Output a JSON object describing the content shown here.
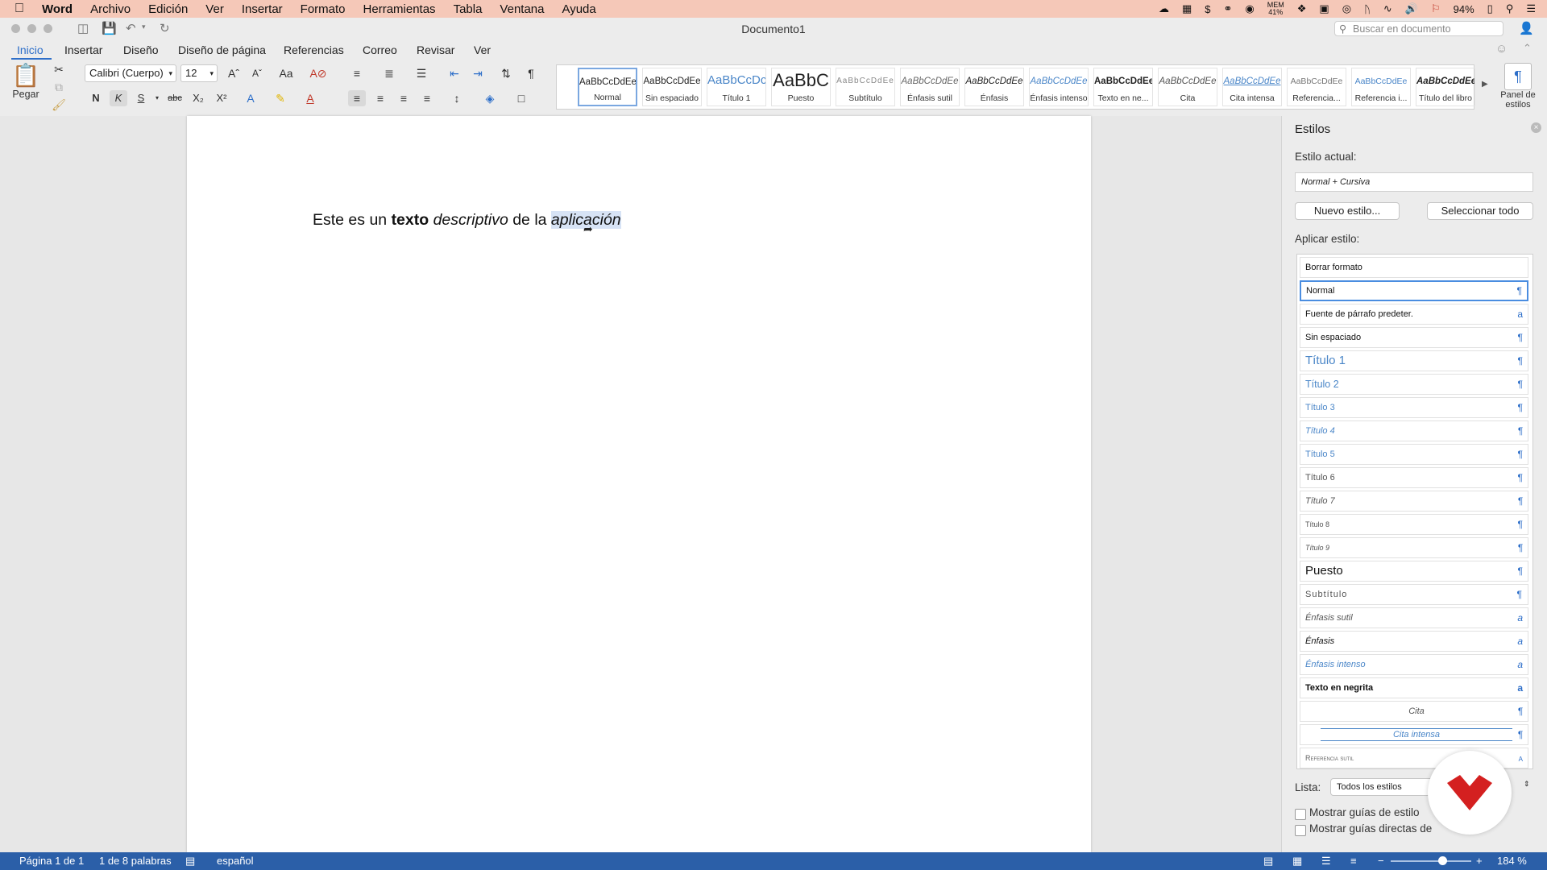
{
  "menubar": {
    "app": "Word",
    "items": [
      "Archivo",
      "Edición",
      "Ver",
      "Insertar",
      "Formato",
      "Herramientas",
      "Tabla",
      "Ventana",
      "Ayuda"
    ],
    "mem_label": "MEM",
    "mem_value": "41%",
    "battery": "94%"
  },
  "window": {
    "title": "Documento1",
    "search_placeholder": "Buscar en documento"
  },
  "tabs": [
    "Inicio",
    "Insertar",
    "Diseño",
    "Diseño de página",
    "Referencias",
    "Correo",
    "Revisar",
    "Ver"
  ],
  "ribbon": {
    "paste_label": "Pegar",
    "font_name": "Calibri (Cuerpo)",
    "font_size": "12",
    "bold": "N",
    "italic": "K",
    "underline": "S",
    "strike": "abc",
    "panel_label_1": "Panel de",
    "panel_label_2": "estilos",
    "styles": [
      {
        "preview": "AaBbCcDdEe",
        "label": "Normal"
      },
      {
        "preview": "AaBbCcDdEe",
        "label": "Sin espaciado"
      },
      {
        "preview": "AaBbCcDc",
        "label": "Título 1"
      },
      {
        "preview": "AaBbC",
        "label": "Puesto"
      },
      {
        "preview": "AaBbCcDdEe",
        "label": "Subtítulo"
      },
      {
        "preview": "AaBbCcDdEe",
        "label": "Énfasis sutil"
      },
      {
        "preview": "AaBbCcDdEe",
        "label": "Énfasis"
      },
      {
        "preview": "AaBbCcDdEe",
        "label": "Énfasis intenso"
      },
      {
        "preview": "AaBbCcDdEe",
        "label": "Texto en ne..."
      },
      {
        "preview": "AaBbCcDdEe",
        "label": "Cita"
      },
      {
        "preview": "AaBbCcDdEe",
        "label": "Cita intensa"
      },
      {
        "preview": "AaBbCcDdEe",
        "label": "Referencia..."
      },
      {
        "preview": "AaBbCcDdEe",
        "label": "Referencia i..."
      },
      {
        "preview": "AaBbCcDdEe",
        "label": "Título del libro"
      }
    ]
  },
  "document": {
    "part1": "Este es un ",
    "part2_bold": "texto",
    "part3": " ",
    "part4_italic": "descriptivo",
    "part5": " de la ",
    "part6_selected": "aplicación"
  },
  "styles_panel": {
    "title": "Estilos",
    "current_label": "Estilo actual:",
    "current_value": "Normal + Cursiva",
    "new_style": "Nuevo estilo...",
    "select_all": "Seleccionar todo",
    "apply_label": "Aplicar estilo:",
    "list": [
      {
        "name": "Borrar formato",
        "sym": ""
      },
      {
        "name": "Normal",
        "sym": "¶"
      },
      {
        "name": "Fuente de párrafo predeter.",
        "sym": "a"
      },
      {
        "name": "Sin espaciado",
        "sym": "¶"
      },
      {
        "name": "Título 1",
        "sym": "¶"
      },
      {
        "name": "Título 2",
        "sym": "¶"
      },
      {
        "name": "Título 3",
        "sym": "¶"
      },
      {
        "name": "Título 4",
        "sym": "¶"
      },
      {
        "name": "Título 5",
        "sym": "¶"
      },
      {
        "name": "Título 6",
        "sym": "¶"
      },
      {
        "name": "Título 7",
        "sym": "¶"
      },
      {
        "name": "Título 8",
        "sym": "¶"
      },
      {
        "name": "Título 9",
        "sym": "¶"
      },
      {
        "name": "Puesto",
        "sym": "¶"
      },
      {
        "name": "Subtítulo",
        "sym": "¶"
      },
      {
        "name": "Énfasis sutil",
        "sym": "a"
      },
      {
        "name": "Énfasis",
        "sym": "a"
      },
      {
        "name": "Énfasis intenso",
        "sym": "a"
      },
      {
        "name": "Texto en negrita",
        "sym": "a"
      },
      {
        "name": "Cita",
        "sym": "¶"
      },
      {
        "name": "Cita intensa",
        "sym": "¶"
      },
      {
        "name": "Referencia sutil",
        "sym": "a"
      }
    ],
    "list_label": "Lista:",
    "list_value": "Todos los estilos",
    "cb1": "Mostrar guías de estilo",
    "cb2": "Mostrar guías directas de"
  },
  "status": {
    "page": "Página 1 de 1",
    "words": "1 de 8 palabras",
    "language": "español",
    "zoom": "184 %",
    "zoom_fraction": 0.64
  },
  "colors": {
    "accent": "#2e6fc9",
    "statusbar": "#2b5fa8",
    "menubar": "#f5c8b8",
    "selection": "#d7e3f5",
    "logo": "#d42020"
  }
}
